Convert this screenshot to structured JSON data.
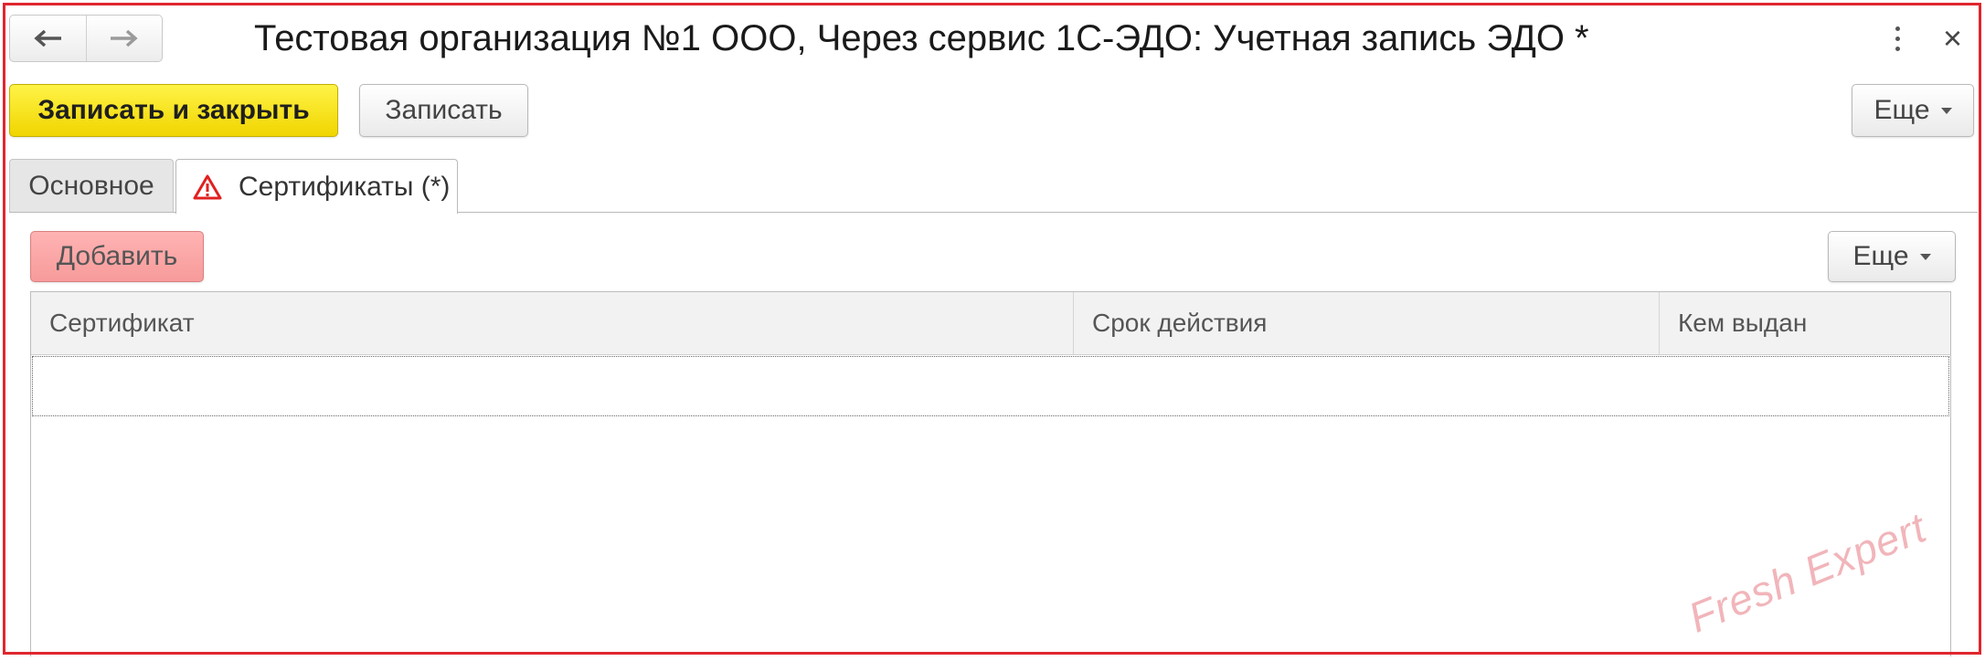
{
  "window": {
    "title": "Тестовая организация №1 ООО, Через сервис 1С-ЭДО: Учетная запись ЭДО *",
    "back_icon": "arrow-left-icon",
    "forward_icon": "arrow-right-icon",
    "more_icon": "more-vertical-icon",
    "close_icon": "close-icon",
    "close_glyph": "×"
  },
  "toolbar": {
    "save_and_close_label": "Записать и закрыть",
    "save_label": "Записать",
    "more_label": "Еще"
  },
  "tabs": [
    {
      "label": "Основное",
      "active": false
    },
    {
      "label": "Сертификаты (*)",
      "active": true,
      "icon": "warning-icon"
    }
  ],
  "certificates_panel": {
    "add_label": "Добавить",
    "more_label": "Еще",
    "columns": [
      "Сертификат",
      "Срок действия",
      "Кем выдан"
    ],
    "rows": []
  },
  "watermark": "Fresh Expert",
  "colors": {
    "primary_button": "#f5de13",
    "add_button": "#f8a5a5",
    "frame_highlight": "#e0262f",
    "warning": "#e02020"
  }
}
